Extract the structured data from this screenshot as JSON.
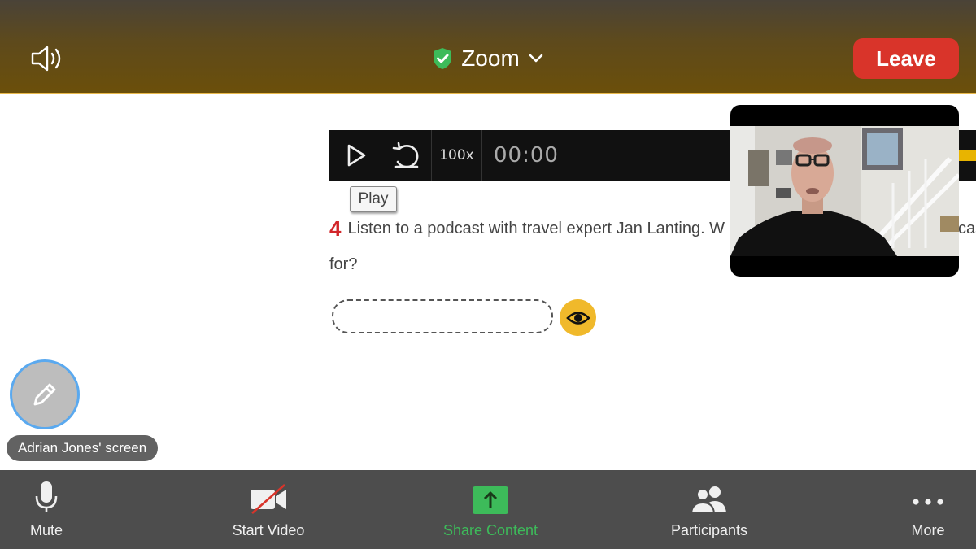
{
  "header": {
    "title": "Zoom",
    "leave_label": "Leave"
  },
  "player": {
    "speed": "100x",
    "time": "00:00",
    "tooltip": "Play"
  },
  "exercise": {
    "number": "4",
    "text": "Listen to a podcast with travel expert Jan Lanting. W",
    "text_tail": "cas",
    "text_cont": "for?",
    "answer_value": "",
    "answer_placeholder": ""
  },
  "screen_share": {
    "owner_label": "Adrian Jones' screen"
  },
  "toolbar": {
    "mute": "Mute",
    "start_video": "Start Video",
    "share_content": "Share Content",
    "participants": "Participants",
    "more": "More"
  },
  "colors": {
    "leave": "#d9342a",
    "share_green": "#3dbb5a",
    "accent_yellow": "#f0b92b",
    "annotate_ring": "#5aa9ef"
  },
  "icons": {
    "speaker": "speaker-icon",
    "shield": "shield-check-icon",
    "chevron": "chevron-down-icon",
    "play": "play-icon",
    "replay": "replay-icon",
    "eye": "eye-icon",
    "pencil": "pencil-icon",
    "mic": "microphone-icon",
    "video_off": "video-off-icon",
    "share": "share-arrow-icon",
    "participants": "participants-icon",
    "more": "more-dots-icon"
  }
}
